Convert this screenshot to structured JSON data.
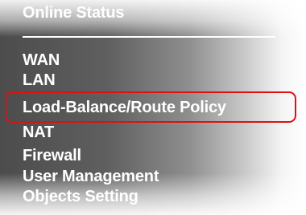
{
  "menu": {
    "items": [
      {
        "label": "Online Status"
      },
      {
        "label": "WAN"
      },
      {
        "label": "LAN"
      },
      {
        "label": "Load-Balance/Route Policy"
      },
      {
        "label": "NAT"
      },
      {
        "label": "Firewall"
      },
      {
        "label": "User Management"
      },
      {
        "label": "Objects Setting"
      }
    ]
  },
  "highlight_color": "#e01010"
}
